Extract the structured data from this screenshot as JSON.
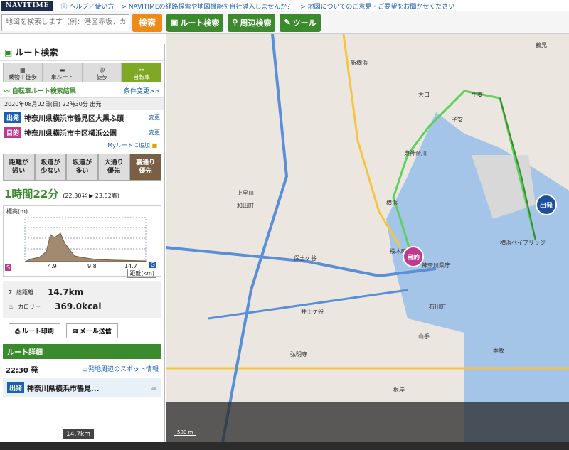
{
  "topbar": {
    "logo": "NAVITIME",
    "links": [
      "ヘルプ／使い方",
      "NAVITIMEの経路探索や地図機能を自社導入しませんか？",
      "地図についてのご意見・ご要望をお聞かせください"
    ]
  },
  "toolbar": {
    "search_placeholder": "地図を検索します（例：港区赤坂、カフェ",
    "search_label": "検索",
    "route_label": "ルート検索",
    "nearby_label": "周辺検索",
    "tools_label": "ツール"
  },
  "sidebar": {
    "title": "ルート検索",
    "modes": [
      {
        "label": "乗物＋徒歩"
      },
      {
        "label": "車ルート"
      },
      {
        "label": "徒歩"
      },
      {
        "label": "自転車",
        "active": true
      }
    ],
    "result_title": "自転車ルート検索結果",
    "change_conditions": "条件変更>>",
    "datetime": "2020年08月02日(日) 22時30分 出発",
    "from_tag": "出発",
    "from": "神奈川県横浜市鶴見区大黒ふ頭",
    "to_tag": "目的",
    "to": "神奈川県横浜市中区横浜公園",
    "change": "変更",
    "myroute": "Myルートに追加",
    "options": [
      {
        "label": "距離が\n短い"
      },
      {
        "label": "坂道が\n少ない"
      },
      {
        "label": "坂道が\n多い"
      },
      {
        "label": "大通り\n優先"
      },
      {
        "label": "裏通り\n優先",
        "active": true
      }
    ],
    "duration": "1時間22分",
    "duration_detail": "(22:30発 ▶ 23:52着)",
    "elev_label": "標高(m)",
    "elev_ticks": [
      "4.9",
      "9.8",
      "14.7"
    ],
    "elev_start": "S",
    "elev_goal": "G",
    "distance_axis": "距離(km)",
    "stats": {
      "distance_label": "総距離",
      "distance": "14.7km",
      "calorie_label": "カロリー",
      "calorie": "369.0kcal"
    },
    "print": "ルート印刷",
    "mail": "メール送信",
    "detail_title": "ルート詳細",
    "dep_time": "22:30 発",
    "spots": "出発地周辺のスポット情報",
    "dep_tag": "出発",
    "dep_place": "神奈川県横浜市鶴見..."
  },
  "tooltip": "14.7km",
  "map": {
    "labels": [
      "新横浜",
      "大口",
      "生麦",
      "子安",
      "東神奈川",
      "横浜",
      "神奈川県庁",
      "石川町",
      "保土ケ谷",
      "山手",
      "根岸",
      "鶴見",
      "横浜ベイブリッジ",
      "本牧",
      "和田町",
      "上星川",
      "井土ケ谷",
      "弘明寺",
      "桜木町"
    ],
    "start_tag": "出発",
    "goal_tag": "目的",
    "scale": "500 m"
  }
}
